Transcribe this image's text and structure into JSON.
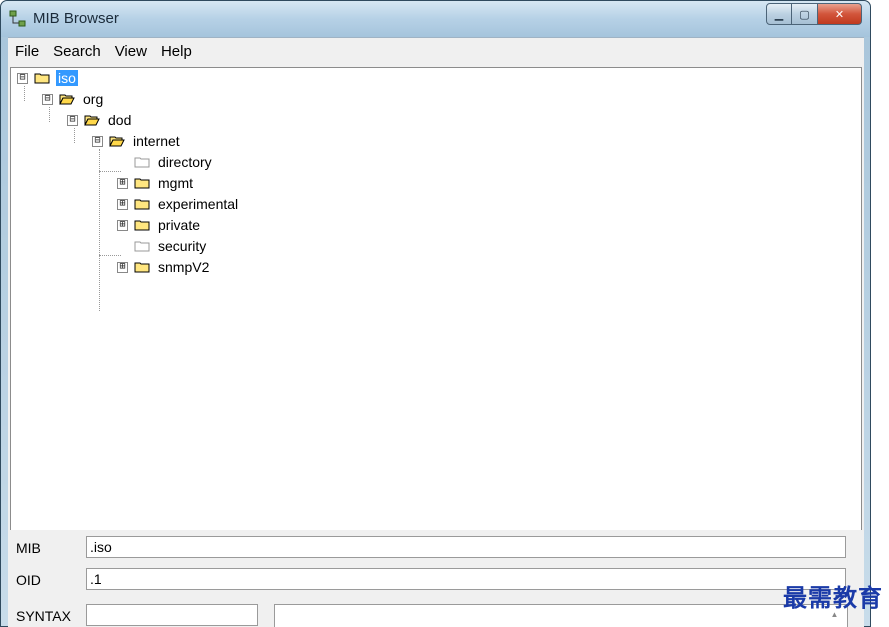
{
  "window": {
    "title": "MIB Browser"
  },
  "menu": {
    "items": [
      "File",
      "Search",
      "View",
      "Help"
    ]
  },
  "tree": {
    "nodes": [
      {
        "label": "iso",
        "expander": "⊟",
        "selected": true
      },
      {
        "label": "org",
        "expander": "⊟"
      },
      {
        "label": "dod",
        "expander": "⊟"
      },
      {
        "label": "internet",
        "expander": "⊟"
      },
      {
        "label": "directory",
        "expander": ""
      },
      {
        "label": "mgmt",
        "expander": "⊞"
      },
      {
        "label": "experimental",
        "expander": "⊞"
      },
      {
        "label": "private",
        "expander": "⊞"
      },
      {
        "label": "security",
        "expander": ""
      },
      {
        "label": "snmpV2",
        "expander": "⊞"
      }
    ]
  },
  "fields": {
    "mib_label": "MIB",
    "mib_value": ".iso",
    "oid_label": "OID",
    "oid_value": ".1",
    "syntax_label": "SYNTAX",
    "syntax_value": "",
    "description_value": ""
  },
  "watermark": "最需教育",
  "colors": {
    "selection": "#3399ff",
    "folder": "#ffe680",
    "close_button": "#c0391e"
  }
}
